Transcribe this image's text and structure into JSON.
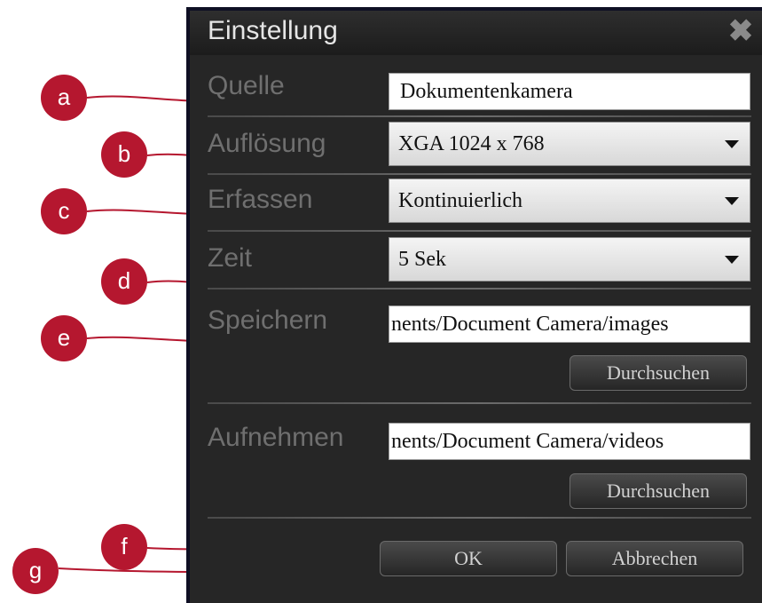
{
  "dialog": {
    "title": "Einstellung",
    "close_icon": "close-icon"
  },
  "rows": {
    "source": {
      "label": "Quelle",
      "value": "Dokumentenkamera"
    },
    "resolution": {
      "label": "Auflösung",
      "value": "XGA 1024 x 768"
    },
    "capture": {
      "label": "Erfassen",
      "value": "Kontinuierlich"
    },
    "time": {
      "label": "Zeit",
      "value": "5 Sek"
    },
    "save": {
      "label": "Speichern",
      "value": "nents/Document Camera/images",
      "browse": "Durchsuchen"
    },
    "record": {
      "label": "Aufnehmen",
      "value": "nents/Document Camera/videos",
      "browse": "Durchsuchen"
    }
  },
  "buttons": {
    "ok": "OK",
    "cancel": "Abbrechen"
  },
  "callouts": [
    "a",
    "b",
    "c",
    "d",
    "e",
    "f",
    "g"
  ],
  "colors": {
    "callout": "#b5172f",
    "dialog_bg": "#262626"
  }
}
